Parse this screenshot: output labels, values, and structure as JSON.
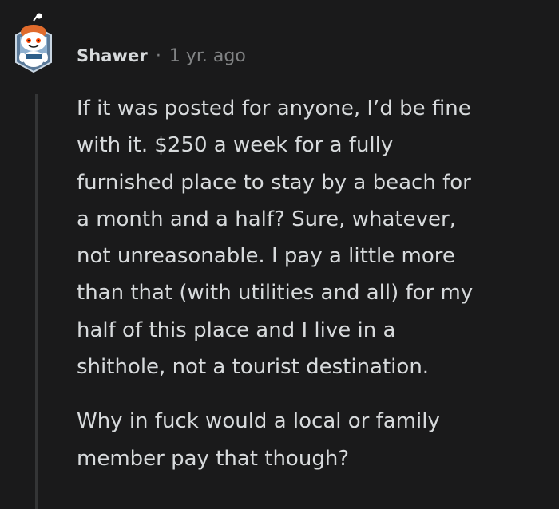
{
  "comment": {
    "author": "Shawer",
    "separator": "·",
    "time": "1 yr. ago",
    "avatar_icon": "reddit-snoo-avatar-icon",
    "paragraphs": [
      {
        "lines": [
          "If it was posted for anyone, I’d be fine",
          "with it. $250 a week for a fully",
          "furnished place to stay by a beach for",
          "a month and a half? Sure, whatever,",
          "not unreasonable. I pay a little more",
          "than that (with utilities and all) for my",
          "half of this place and I live in a",
          "shithole, not a tourist destination."
        ]
      },
      {
        "lines": [
          "Why in fuck would a local or family",
          "member pay that though?"
        ]
      }
    ]
  },
  "colors": {
    "background": "#1a1a1b",
    "text": "#d7dadc",
    "meta": "#818384",
    "thread_line": "#343536"
  }
}
